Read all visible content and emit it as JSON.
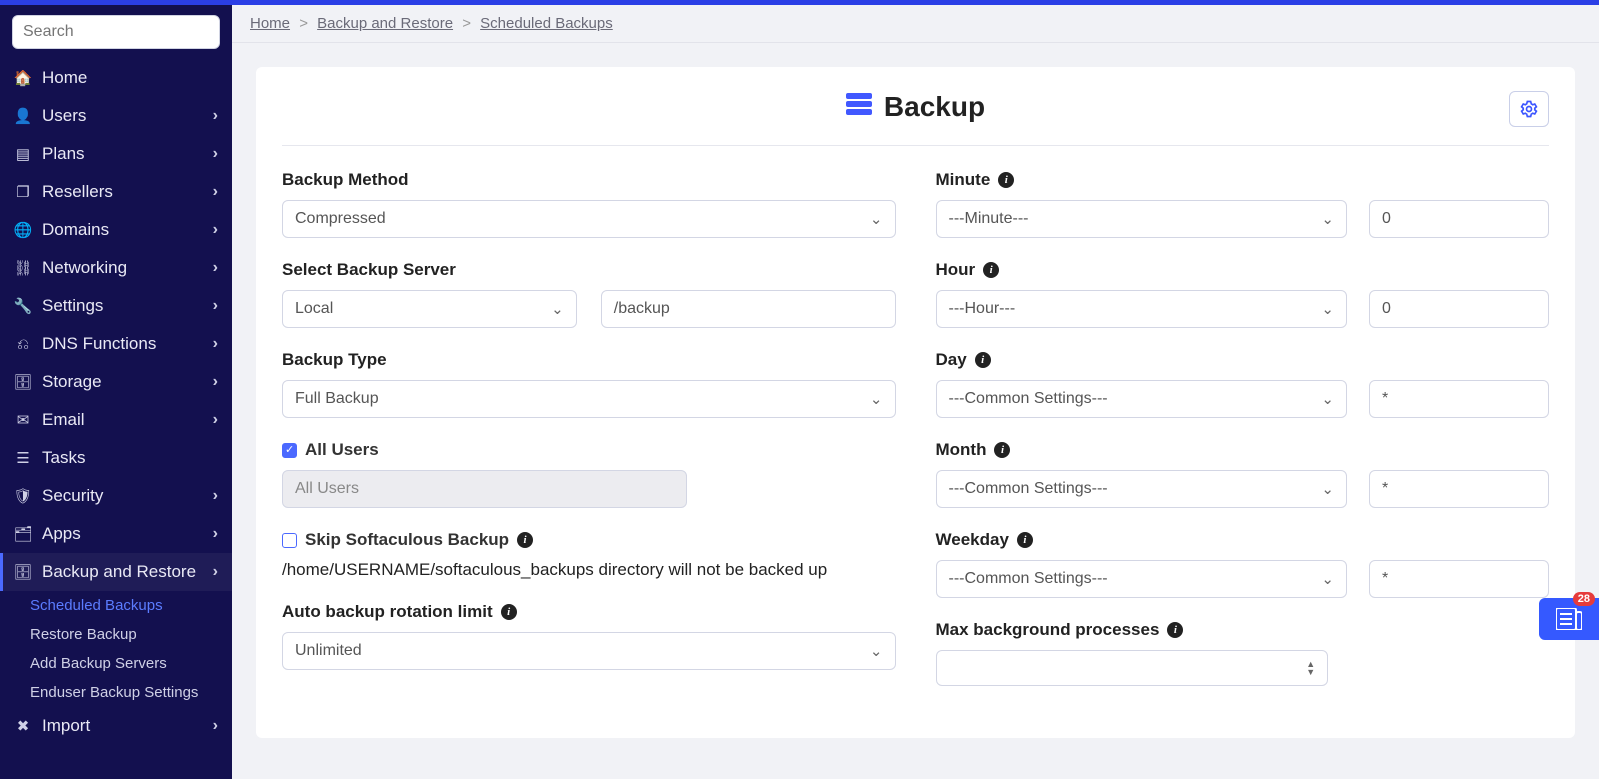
{
  "search": {
    "placeholder": "Search"
  },
  "sidebar": {
    "items": [
      {
        "label": "Home",
        "icon": "⌂",
        "expandable": false
      },
      {
        "label": "Users",
        "icon": "👤",
        "expandable": true
      },
      {
        "label": "Plans",
        "icon": "▤",
        "expandable": true
      },
      {
        "label": "Resellers",
        "icon": "❐",
        "expandable": true
      },
      {
        "label": "Domains",
        "icon": "🌐",
        "expandable": true
      },
      {
        "label": "Networking",
        "icon": "⛓",
        "expandable": true
      },
      {
        "label": "Settings",
        "icon": "🔧",
        "expandable": true
      },
      {
        "label": "DNS Functions",
        "icon": "⎇",
        "expandable": true
      },
      {
        "label": "Storage",
        "icon": "🗄",
        "expandable": true
      },
      {
        "label": "Email",
        "icon": "✉",
        "expandable": true
      },
      {
        "label": "Tasks",
        "icon": "☰",
        "expandable": false
      },
      {
        "label": "Security",
        "icon": "🛡",
        "expandable": true
      },
      {
        "label": "Apps",
        "icon": "🗂",
        "expandable": true
      },
      {
        "label": "Backup and Restore",
        "icon": "🗄",
        "expandable": true
      },
      {
        "label": "Import",
        "icon": "✖",
        "expandable": true
      }
    ],
    "sub_backup": [
      {
        "label": "Scheduled Backups",
        "active": true
      },
      {
        "label": "Restore Backup",
        "active": false
      },
      {
        "label": "Add Backup Servers",
        "active": false
      },
      {
        "label": "Enduser Backup Settings",
        "active": false
      }
    ]
  },
  "breadcrumb": {
    "a": "Home",
    "b": "Backup and Restore",
    "c": "Scheduled Backups"
  },
  "page": {
    "title": "Backup"
  },
  "form": {
    "backup_method": {
      "label": "Backup Method",
      "value": "Compressed"
    },
    "backup_server": {
      "label": "Select Backup Server",
      "value": "Local",
      "path": "/backup"
    },
    "backup_type": {
      "label": "Backup Type",
      "value": "Full Backup"
    },
    "all_users": {
      "label": "All Users",
      "checked": true,
      "input_value": "All Users"
    },
    "skip_soft": {
      "label": "Skip Softaculous Backup",
      "checked": false,
      "hint": "/home/USERNAME/softaculous_backups directory will not be backed up"
    },
    "rotation": {
      "label": "Auto backup rotation limit",
      "value": "Unlimited"
    },
    "minute": {
      "label": "Minute",
      "select": "---Minute---",
      "value": "0"
    },
    "hour": {
      "label": "Hour",
      "select": "---Hour---",
      "value": "0"
    },
    "day": {
      "label": "Day",
      "select": "---Common Settings---",
      "value": "*"
    },
    "month": {
      "label": "Month",
      "select": "---Common Settings---",
      "value": "*"
    },
    "weekday": {
      "label": "Weekday",
      "select": "---Common Settings---",
      "value": "*"
    },
    "maxbg": {
      "label": "Max background processes"
    }
  },
  "widget": {
    "badge": "28"
  }
}
